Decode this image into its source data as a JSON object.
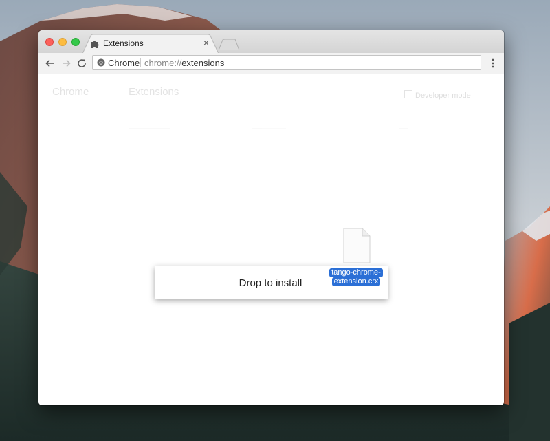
{
  "browser": {
    "tab": {
      "title": "Extensions",
      "close_glyph": "×"
    },
    "omnibox": {
      "scheme_label": "Chrome",
      "url_prefix": "chrome://",
      "url_path": "extensions"
    }
  },
  "page": {
    "sidebar_title": "Chrome",
    "title": "Extensions",
    "developer_mode_label": "Developer mode"
  },
  "overlay": {
    "drop_label": "Drop to install"
  },
  "dragged_file": {
    "name_line1": "tango-chrome-",
    "name_line2": "extension.crx"
  },
  "icons": {
    "tab": "puzzle-piece-icon",
    "back": "back-arrow-icon",
    "forward": "forward-arrow-icon",
    "reload": "reload-icon",
    "omnibox": "chrome-logo-icon",
    "menu": "kebab-menu-icon",
    "file": "file-document-icon"
  },
  "colors": {
    "file_label_highlight": "#2b6fd6",
    "traffic_close": "#fc605b",
    "traffic_minimize": "#fdbc40",
    "traffic_zoom": "#34c84a"
  }
}
